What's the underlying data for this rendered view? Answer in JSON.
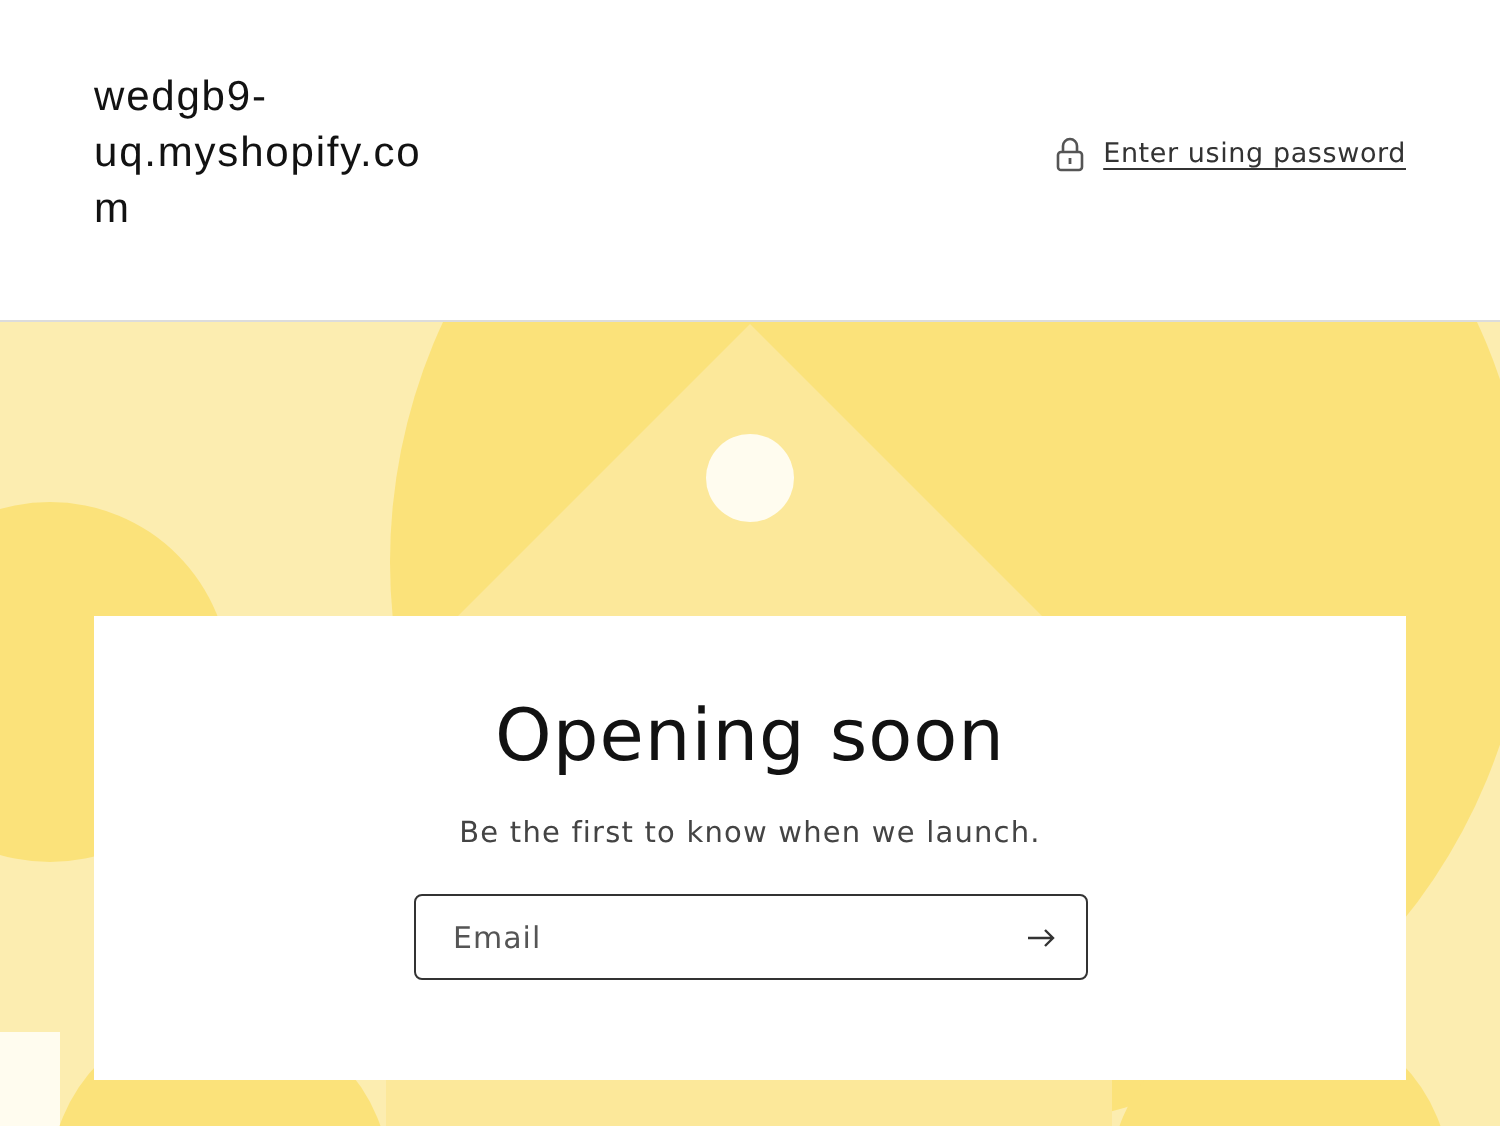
{
  "header": {
    "site_name": "wedgb9-uq.myshopify.com",
    "password_link": "Enter using password"
  },
  "newsletter": {
    "heading": "Opening soon",
    "subheading": "Be the first to know when we launch.",
    "email_field": {
      "placeholder": "Email"
    }
  }
}
